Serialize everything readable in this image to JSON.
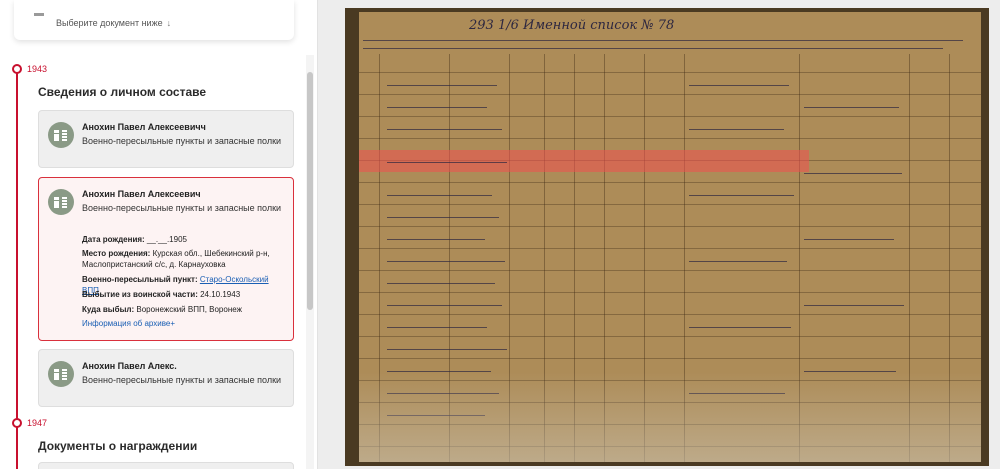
{
  "document_select": {
    "hint": "Выберите документ ниже",
    "arrow": "↓"
  },
  "timeline": [
    {
      "year": "1943",
      "section_title": "Сведения о личном составе"
    },
    {
      "year": "1947",
      "section_title": "Документы о награждении"
    }
  ],
  "cards": [
    {
      "name": "Анохин Павел Алексеевичч",
      "unit": "Военно-пересыльные пункты и запасные полки"
    },
    {
      "name": "Анохин Павел Алексеевич",
      "unit": "Военно-пересыльные пункты и запасные полки",
      "details": {
        "birth_date_label": "Дата рождения:",
        "birth_date": "__.__.1905",
        "birth_place_label": "Место рождения:",
        "birth_place": "Курская обл., Шебекинский р-н, Маслопристанский с/с, д. Карнауховка",
        "transit_point_label": "Военно-пересыльный пункт:",
        "transit_point": "Старо-Оскольский ВПП",
        "departure_label": "Выбытие из воинской части:",
        "departure": "24.10.1943",
        "destination_label": "Куда выбыл:",
        "destination": "Воронежский ВПП, Воронеж",
        "archive_link": "Информация об архиве+"
      }
    },
    {
      "name": "Анохин Павел Алекс.",
      "unit": "Военно-пересыльные пункты и запасные полки"
    }
  ],
  "viewer": {
    "header_text": "293  1/6       Именной список       № 78"
  },
  "colors": {
    "accent": "#c8102e",
    "link": "#1a5fb4",
    "highlight": "#f05050"
  }
}
